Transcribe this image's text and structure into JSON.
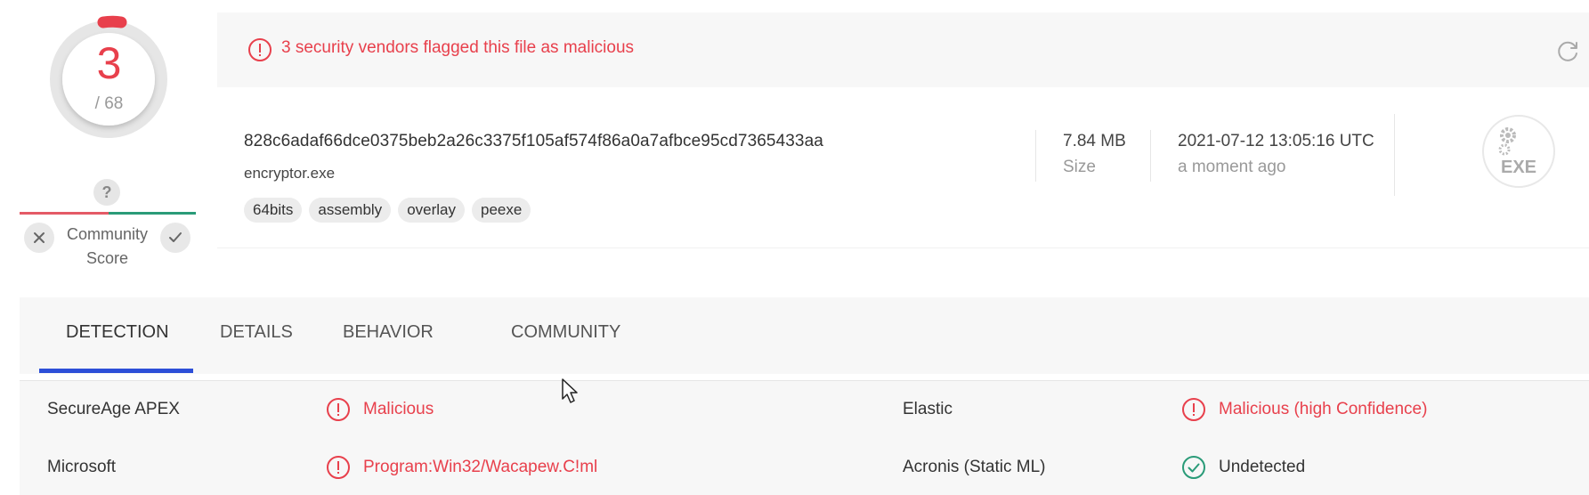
{
  "score": {
    "detected": "3",
    "total": "/ 68",
    "gauge_color": "#e8404c"
  },
  "community": {
    "badge": "?",
    "label_line1": "Community",
    "label_line2": "Score",
    "dislike_icon": "x-icon",
    "like_icon": "check-icon"
  },
  "banner": {
    "icon": "alert-circle-icon",
    "text": "3 security vendors flagged this file as malicious",
    "refresh_icon": "refresh-icon"
  },
  "file": {
    "hash": "828c6adaf66dce0375beb2a26c3375f105af574f86a0a7afbce95cd7365433aa",
    "name": "encryptor.exe",
    "tags": [
      "64bits",
      "assembly",
      "overlay",
      "peexe"
    ],
    "size_value": "7.84 MB",
    "size_label": "Size",
    "date_value": "2021-07-12 13:05:16 UTC",
    "date_relative": "a moment ago",
    "type_icon_label": "EXE"
  },
  "tabs": [
    {
      "label": "DETECTION",
      "active": true
    },
    {
      "label": "DETAILS",
      "active": false
    },
    {
      "label": "BEHAVIOR",
      "active": false
    },
    {
      "label": "COMMUNITY",
      "active": false
    }
  ],
  "detections": [
    {
      "vendor": "SecureAge APEX",
      "result": "Malicious",
      "status": "malicious"
    },
    {
      "vendor": "Elastic",
      "result": "Malicious (high Confidence)",
      "status": "malicious"
    },
    {
      "vendor": "Microsoft",
      "result": "Program:Win32/Wacapew.C!ml",
      "status": "malicious"
    },
    {
      "vendor": "Acronis (Static ML)",
      "result": "Undetected",
      "status": "undetected"
    }
  ],
  "colors": {
    "malicious": "#e8404c",
    "undetected": "#2a9b78",
    "accent": "#2d4fd8"
  }
}
